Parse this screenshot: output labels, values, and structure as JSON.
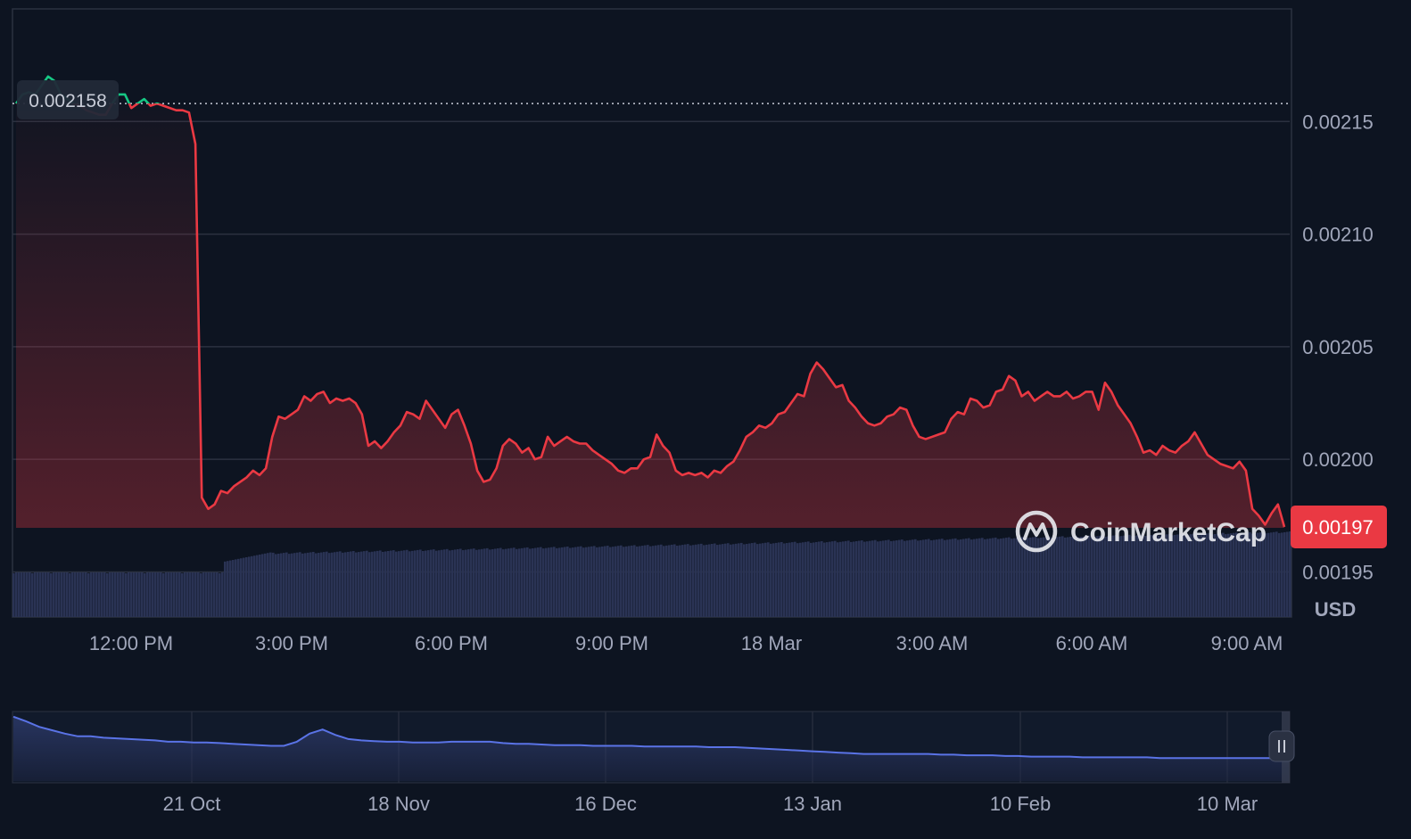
{
  "chart_data": [
    {
      "type": "line",
      "ylim": [
        0.00193,
        0.0022
      ],
      "y_ticks": [
        0.00215,
        0.0021,
        0.00205,
        0.002,
        0.00195
      ],
      "y_tick_labels": [
        "0.00215",
        "0.00210",
        "0.00205",
        "0.00200",
        "0.00195"
      ],
      "x_tick_labels": [
        "12:00 PM",
        "3:00 PM",
        "6:00 PM",
        "9:00 PM",
        "18 Mar",
        "3:00 AM",
        "6:00 AM",
        "9:00 AM"
      ],
      "reference_value": 0.002158,
      "reference_label": "0.002158",
      "current_value": 0.00197,
      "current_label": "0.00197",
      "currency": "USD",
      "brand": "CoinMarketCap",
      "colors": {
        "up": "#16c784",
        "down": "#ea3943",
        "volume": "#2a3354",
        "grid": "#2b3140",
        "reference": "#c7cbd6"
      },
      "series": [
        {
          "values": [
            0.002158,
            0.002162,
            0.002163,
            0.002162,
            0.002166,
            0.00217,
            0.002168,
            0.002162,
            0.00216,
            0.002158,
            0.002157,
            0.002155,
            0.002154,
            0.002153,
            0.002153,
            0.002158,
            0.002162,
            0.002162,
            0.002156,
            0.002158,
            0.00216,
            0.002157,
            0.002158,
            0.002157,
            0.002156,
            0.002155,
            0.002155,
            0.002154,
            0.00214,
            0.001983,
            0.001978,
            0.00198,
            0.001986,
            0.001985,
            0.001988,
            0.00199,
            0.001992,
            0.001995,
            0.001993,
            0.001996,
            0.00201,
            0.002019,
            0.002018,
            0.00202,
            0.002022,
            0.002028,
            0.002026,
            0.002029,
            0.00203,
            0.002025,
            0.002027,
            0.002026,
            0.002027,
            0.002025,
            0.00202,
            0.002006,
            0.002008,
            0.002005,
            0.002008,
            0.002012,
            0.002015,
            0.002021,
            0.00202,
            0.002018,
            0.002026,
            0.002022,
            0.002018,
            0.002014,
            0.00202,
            0.002022,
            0.002015,
            0.002007,
            0.001995,
            0.00199,
            0.001991,
            0.001996,
            0.002006,
            0.002009,
            0.002007,
            0.002003,
            0.002005,
            0.002,
            0.002001,
            0.00201,
            0.002006,
            0.002008,
            0.00201,
            0.002008,
            0.002007,
            0.002007,
            0.002004,
            0.002002,
            0.002,
            0.001998,
            0.001995,
            0.001994,
            0.001996,
            0.001996,
            0.002,
            0.002001,
            0.002011,
            0.002006,
            0.002003,
            0.001995,
            0.001993,
            0.001994,
            0.001993,
            0.001994,
            0.001992,
            0.001995,
            0.001994,
            0.001997,
            0.001999,
            0.002004,
            0.00201,
            0.002012,
            0.002015,
            0.002014,
            0.002016,
            0.00202,
            0.002021,
            0.002025,
            0.002029,
            0.002028,
            0.002038,
            0.002043,
            0.00204,
            0.002036,
            0.002032,
            0.002033,
            0.002026,
            0.002023,
            0.002019,
            0.002016,
            0.002015,
            0.002016,
            0.002019,
            0.00202,
            0.002023,
            0.002022,
            0.002015,
            0.00201,
            0.002009,
            0.00201,
            0.002011,
            0.002012,
            0.002018,
            0.002021,
            0.00202,
            0.002027,
            0.002026,
            0.002023,
            0.002024,
            0.00203,
            0.002031,
            0.002037,
            0.002035,
            0.002028,
            0.00203,
            0.002026,
            0.002028,
            0.00203,
            0.002028,
            0.002028,
            0.00203,
            0.002027,
            0.002028,
            0.00203,
            0.00203,
            0.002022,
            0.002034,
            0.00203,
            0.002024,
            0.00202,
            0.002016,
            0.00201,
            0.002003,
            0.002004,
            0.002002,
            0.002006,
            0.002004,
            0.002003,
            0.002006,
            0.002008,
            0.002012,
            0.002007,
            0.002002,
            0.002,
            0.001998,
            0.001997,
            0.001996,
            0.001999,
            0.001995,
            0.001978,
            0.001975,
            0.001971,
            0.001976,
            0.00198,
            0.00197
          ]
        }
      ]
    },
    {
      "type": "area",
      "x_tick_labels": [
        "21 Oct",
        "18 Nov",
        "16 Dec",
        "13 Jan",
        "10 Feb",
        "10 Mar"
      ],
      "series": [
        {
          "values": [
            0.95,
            0.88,
            0.8,
            0.75,
            0.7,
            0.66,
            0.66,
            0.64,
            0.63,
            0.62,
            0.61,
            0.6,
            0.58,
            0.58,
            0.57,
            0.57,
            0.56,
            0.55,
            0.54,
            0.53,
            0.52,
            0.52,
            0.58,
            0.7,
            0.76,
            0.68,
            0.62,
            0.6,
            0.59,
            0.58,
            0.58,
            0.57,
            0.57,
            0.57,
            0.58,
            0.58,
            0.58,
            0.58,
            0.56,
            0.55,
            0.55,
            0.54,
            0.53,
            0.53,
            0.53,
            0.52,
            0.52,
            0.52,
            0.52,
            0.51,
            0.51,
            0.51,
            0.51,
            0.51,
            0.5,
            0.5,
            0.5,
            0.49,
            0.48,
            0.47,
            0.46,
            0.45,
            0.44,
            0.43,
            0.42,
            0.41,
            0.4,
            0.4,
            0.4,
            0.4,
            0.4,
            0.4,
            0.39,
            0.39,
            0.38,
            0.38,
            0.38,
            0.37,
            0.37,
            0.36,
            0.36,
            0.36,
            0.36,
            0.35,
            0.35,
            0.35,
            0.35,
            0.35,
            0.35,
            0.34,
            0.34,
            0.34,
            0.34,
            0.34,
            0.34,
            0.34,
            0.34,
            0.34,
            0.34,
            0.34
          ]
        }
      ]
    }
  ]
}
